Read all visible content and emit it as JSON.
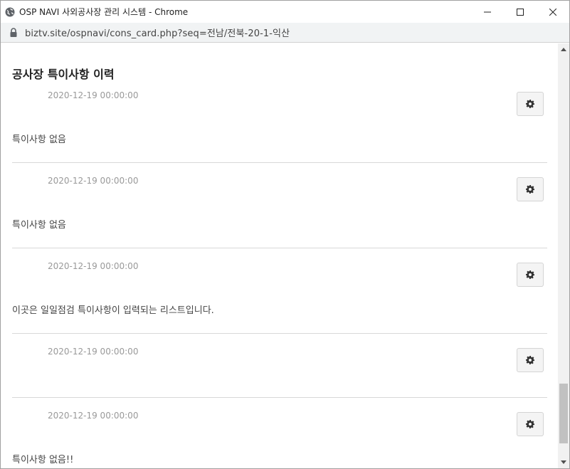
{
  "window": {
    "title": "OSP NAVI 사외공사장 관리 시스템 - Chrome",
    "url": "biztv.site/ospnavi/cons_card.php?seq=전남/전북-20-1-익산"
  },
  "page": {
    "heading": "공사장 특이사항 이력",
    "entries": [
      {
        "date": "2020-12-19 00:00:00",
        "note": "특이사항 없음"
      },
      {
        "date": "2020-12-19 00:00:00",
        "note": "특이사항 없음"
      },
      {
        "date": "2020-12-19 00:00:00",
        "note": "이곳은 일일점검 특이사항이 입력되는 리스트입니다."
      },
      {
        "date": "2020-12-19 00:00:00",
        "note": ""
      },
      {
        "date": "2020-12-19 00:00:00",
        "note": "특이사항 없음!!"
      }
    ]
  },
  "icons": {
    "title": "globe-icon",
    "address": "lock-icon",
    "entry_action": "gear-icon"
  }
}
